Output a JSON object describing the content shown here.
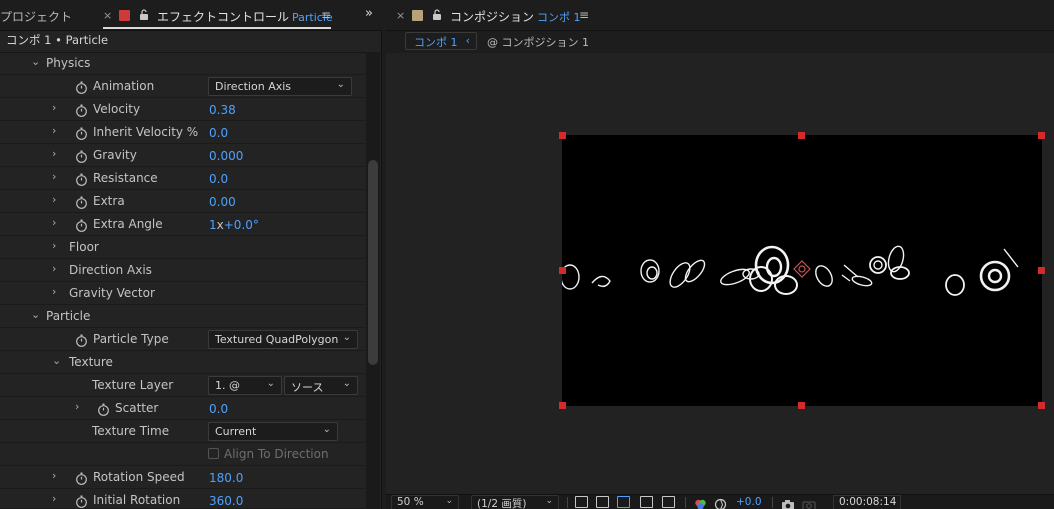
{
  "left_panel": {
    "tab_project": "プロジェクト",
    "tab_effect_title": "エフェクトコントロール",
    "tab_effect_layer": "Particle",
    "breadcrumb": "コンポ 1 • Particle",
    "swatch_color": "#cf3a3a"
  },
  "properties": {
    "physics": "Physics",
    "animation_label": "Animation",
    "animation_value": "Direction Axis",
    "velocity_label": "Velocity",
    "velocity_value": "0.38",
    "inherit_velocity_label": "Inherit Velocity %",
    "inherit_velocity_value": "0.0",
    "gravity_label": "Gravity",
    "gravity_value": "0.000",
    "resistance_label": "Resistance",
    "resistance_value": "0.0",
    "extra_label": "Extra",
    "extra_value": "0.00",
    "extra_angle_label": "Extra Angle",
    "extra_angle_rev": "1",
    "extra_angle_x": "x",
    "extra_angle_deg": "+0.0°",
    "floor": "Floor",
    "direction_axis": "Direction Axis",
    "gravity_vector": "Gravity Vector",
    "particle": "Particle",
    "particle_type_label": "Particle Type",
    "particle_type_value": "Textured QuadPolygon",
    "texture": "Texture",
    "texture_layer_label": "Texture Layer",
    "texture_layer_value": "1. @",
    "texture_source_value": "ソース",
    "scatter_label": "Scatter",
    "scatter_value": "0.0",
    "texture_time_label": "Texture Time",
    "texture_time_value": "Current",
    "align_label": "Align To Direction",
    "rotation_speed_label": "Rotation Speed",
    "rotation_speed_value": "180.0",
    "initial_rotation_label": "Initial Rotation",
    "initial_rotation_value": "360.0"
  },
  "right_panel": {
    "tab_title": "コンポジション",
    "tab_comp": "コンポ 1",
    "comp_chip": "コンポ 1",
    "comp_path": "@ コンポジション 1",
    "swatch_color": "#b8a27a"
  },
  "bottom_bar": {
    "zoom": "50 %",
    "resolution": "(1/2 画質)",
    "exposure": "+0.0",
    "timecode": "0:00:08:14"
  },
  "icons": {
    "close": "×",
    "lock": "🔓",
    "menu": "≡",
    "expand": "»",
    "chevron_right": "›",
    "chevron_down": "⌄",
    "chevron_left": "‹",
    "stopwatch": "stopwatch-icon"
  },
  "colors": {
    "accent_blue": "#4ea1ff",
    "handle_red": "#d32a2a"
  }
}
